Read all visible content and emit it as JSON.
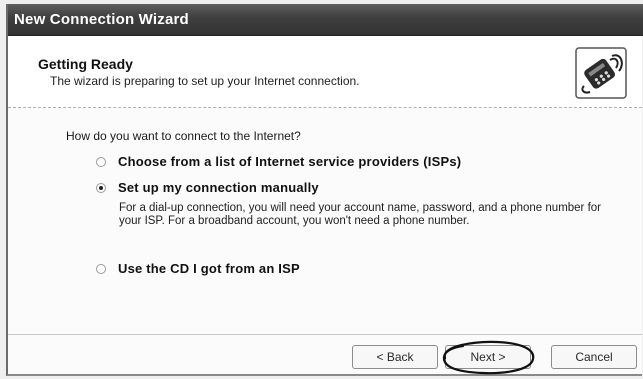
{
  "window": {
    "title": "New Connection Wizard"
  },
  "header": {
    "title": "Getting Ready",
    "subtitle": "The wizard is preparing to set up your Internet connection.",
    "icon": "phone-connection-icon"
  },
  "body": {
    "question": "How do you want to connect to the Internet?",
    "options": [
      {
        "label": "Choose from a list of Internet service providers (ISPs)",
        "selected": false
      },
      {
        "label": "Set up my connection manually",
        "selected": true
      },
      {
        "label": "Use the CD I got from an ISP",
        "selected": false
      }
    ],
    "manual_description": "For a dial-up connection, you will need your account name, password, and a phone number for your ISP. For a broadband account, you won't need a phone number."
  },
  "buttons": {
    "back": "< Back",
    "next": "Next >",
    "cancel": "Cancel"
  },
  "annotation": {
    "highlight": "hand-drawn-circle around Next button"
  }
}
